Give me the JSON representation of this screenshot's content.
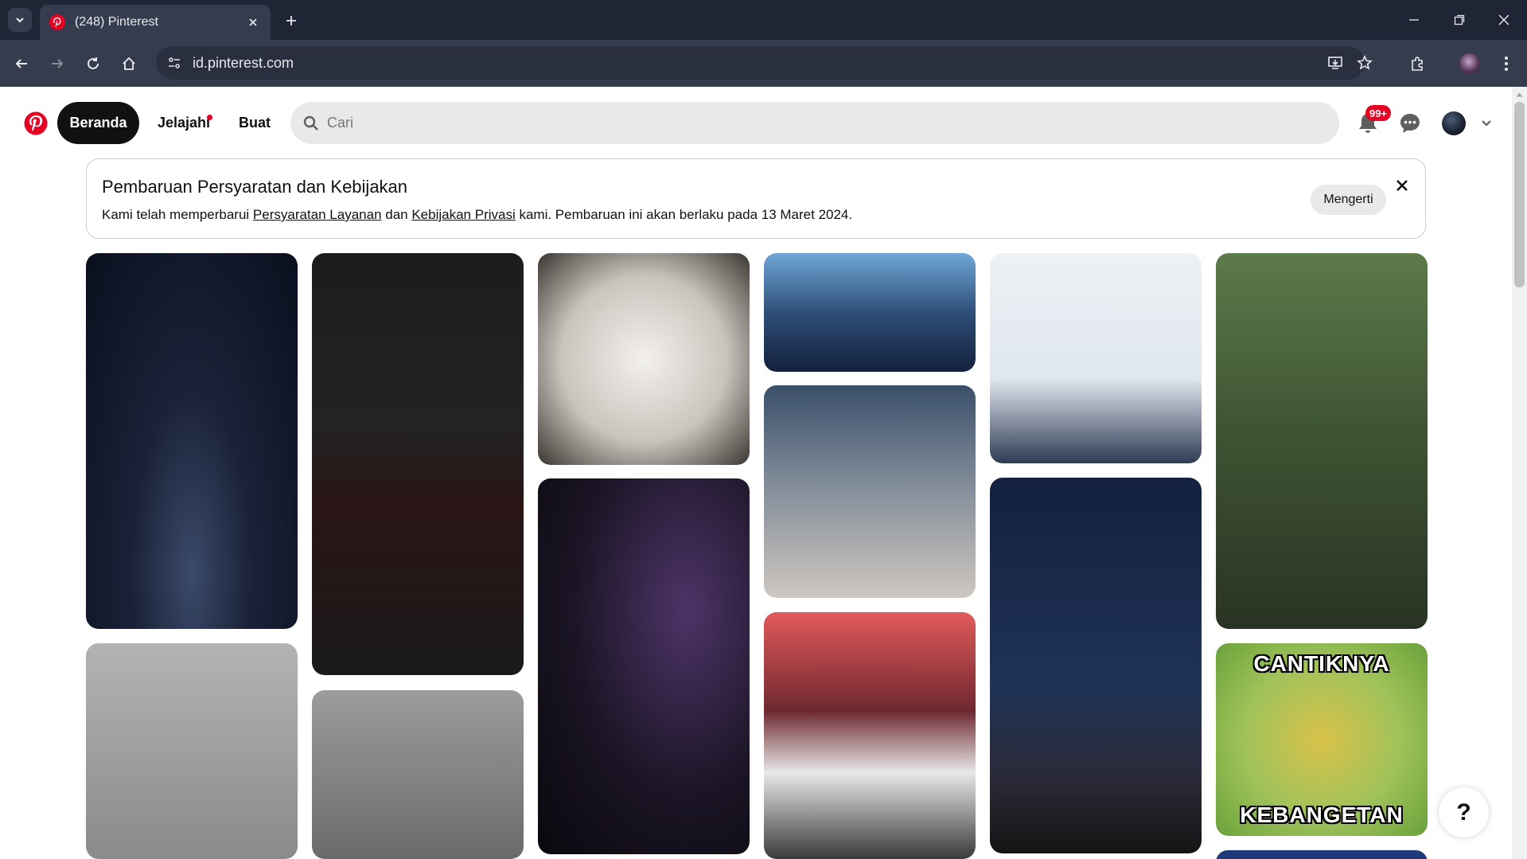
{
  "browser": {
    "tab_title": "(248) Pinterest",
    "url": "id.pinterest.com",
    "accent_color": "#1f2535"
  },
  "header": {
    "nav": {
      "home": "Beranda",
      "explore": "Jelajahi",
      "create": "Buat"
    },
    "search_placeholder": "Cari",
    "notifications_badge": "99+",
    "brand_color": "#e60023"
  },
  "notice": {
    "title": "Pembaruan Persyaratan dan Kebijakan",
    "body_prefix": "Kami telah memperbarui ",
    "terms_link": "Persyaratan Layanan",
    "body_middle": " dan ",
    "privacy_link": "Kebijakan Privasi",
    "body_suffix": " kami. Pembaruan ini akan berlaku pada 13 Maret 2024.",
    "button_label": "Mengerti"
  },
  "pins": [
    {
      "caption_top": "",
      "caption_bottom": ""
    },
    {
      "caption_top": "",
      "caption_bottom": ""
    },
    {
      "caption_top": "",
      "caption_bottom": ""
    },
    {
      "caption_top": "",
      "caption_bottom": ""
    },
    {
      "caption_top": "",
      "caption_bottom": ""
    },
    {
      "caption_top": "",
      "caption_bottom": ""
    },
    {
      "caption_top": "",
      "caption_bottom": ""
    },
    {
      "caption_top": "",
      "caption_bottom": ""
    },
    {
      "caption_top": "",
      "caption_bottom": ""
    },
    {
      "caption_top": "CANTIKNYA",
      "caption_bottom": "KEBANGETAN"
    },
    {
      "caption_top": "",
      "caption_bottom": ""
    },
    {
      "caption_top": "",
      "caption_bottom": ""
    },
    {
      "caption_top": "",
      "caption_bottom": ""
    },
    {
      "caption_top": "",
      "caption_bottom": ""
    }
  ],
  "help_label": "?"
}
